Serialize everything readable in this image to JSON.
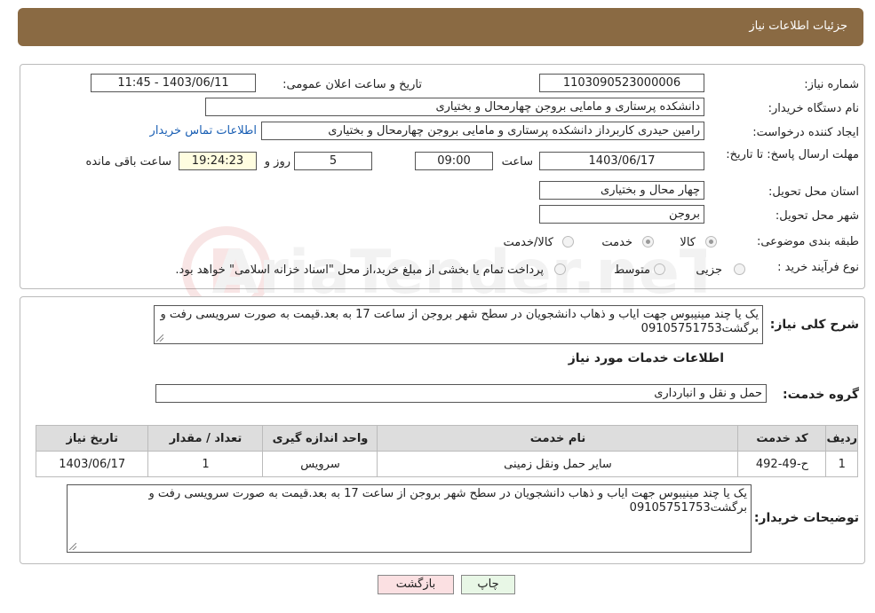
{
  "header": {
    "title": "جزئیات اطلاعات نیاز"
  },
  "info": {
    "need_number_label": "شماره نیاز:",
    "need_number": "1103090523000006",
    "announce_label": "تاریخ و ساعت اعلان عمومی:",
    "announce_value": "1403/06/11 - 11:45",
    "buyer_org_label": "نام دستگاه خریدار:",
    "buyer_org": "دانشکده پرستاری و مامایی بروجن چهارمحال و بختیاری",
    "requester_label": "ایجاد کننده درخواست:",
    "requester": "رامین حیدری کاربرداز دانشکده پرستاری و مامایی بروجن چهارمحال و بختیاری",
    "contact_link": "اطلاعات تماس خریدار",
    "deadline_label": "مهلت ارسال پاسخ: تا تاریخ:",
    "deadline_date": "1403/06/17",
    "time_label": "ساعت",
    "deadline_time": "09:00",
    "days_value": "5",
    "days_label": "روز و",
    "remaining_time": "19:24:23",
    "remaining_label": "ساعت باقی مانده",
    "province_label": "استان محل تحویل:",
    "province": "چهار محال و بختیاری",
    "city_label": "شهر محل تحویل:",
    "city": "بروجن",
    "category_label": "طبقه بندی موضوعی:",
    "category_options": [
      "کالا",
      "خدمت",
      "کالا/خدمت"
    ],
    "process_label": "نوع فرآیند خرید :",
    "process_options": [
      "جزیی",
      "متوسط"
    ],
    "process_note": "پرداخت تمام یا بخشی از مبلغ خرید،از محل \"اسناد خزانه اسلامی\" خواهد بود."
  },
  "details": {
    "desc_label": "شرح کلی نیاز:",
    "desc": "یک یا چند مینیبوس جهت ایاب و ذهاب دانشجویان در سطح شهر بروجن از ساعت 17 به بعد.قیمت به صورت سرویسی رفت و برگشت09105751753",
    "services_title": "اطلاعات خدمات مورد نیاز",
    "service_group_label": "گروه خدمت:",
    "service_group": "حمل و نقل و انبارداری",
    "table": {
      "headers": [
        "ردیف",
        "کد خدمت",
        "نام خدمت",
        "واحد اندازه گیری",
        "تعداد / مقدار",
        "تاریخ نیاز"
      ],
      "rows": [
        [
          "1",
          "ح-49-492",
          "سایر حمل ونقل زمینی",
          "سرویس",
          "1",
          "1403/06/17"
        ]
      ]
    },
    "buyer_notes_label": "توضیحات خریدار:",
    "buyer_notes": "یک یا چند مینیبوس جهت ایاب و ذهاب دانشجویان در سطح شهر بروجن از ساعت 17 به بعد.قیمت به صورت سرویسی رفت و برگشت09105751753"
  },
  "buttons": {
    "print": "چاپ",
    "back": "بازگشت"
  },
  "watermark": "AriaTender.neT"
}
